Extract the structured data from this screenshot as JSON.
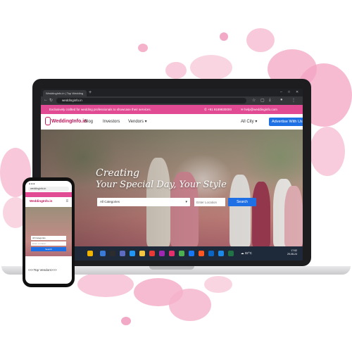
{
  "browser": {
    "tab_title": "WeddingInfo.in | Top Wedding",
    "tab_add": "+",
    "url": "weddinginfo.in",
    "window_controls": [
      "–",
      "□",
      "✕"
    ]
  },
  "site": {
    "topbar": {
      "message": "Exclusively crafted for wedding professionals to showcase their services.",
      "phone": "+91 9189830000",
      "email": "help@weddinginfo.com"
    },
    "logo": "WeddingInfo.in",
    "nav": {
      "blog": "Blog",
      "investors": "Investors",
      "vendors": "Vendors ▾"
    },
    "city_select": "All City ▾",
    "advertise_button": "Advertise With Us",
    "hero": {
      "title_line1": "Creating",
      "title_line2": "Your Special Day, Your Style",
      "category_select": "All Categories",
      "location_placeholder": "Enter Location",
      "search_button": "Search"
    }
  },
  "taskbar": {
    "weather": "32°C",
    "clock_time": "17:52",
    "clock_date": "29-08-24"
  },
  "phone": {
    "url": "weddinginfo.in",
    "logo": "WeddingInfo.in",
    "category_select": "All Categories",
    "location_placeholder": "Enter Location",
    "search_button": "Search",
    "vendors_heading": "<<<Top Vendors>>>"
  },
  "colors": {
    "brand_pink": "#e14b93",
    "button_blue": "#1f6fe5",
    "logo_red": "#c2185b"
  }
}
